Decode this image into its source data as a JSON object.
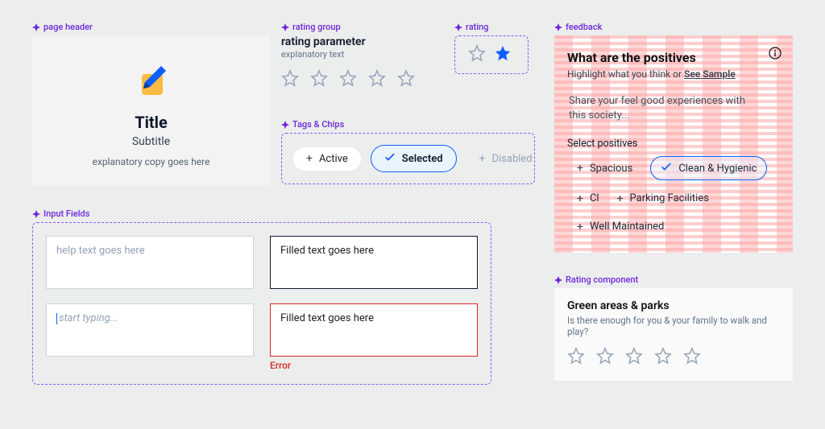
{
  "labels": {
    "page_header": "page header",
    "rating_group": "rating group",
    "rating": "rating",
    "tags_chips": "Tags & Chips",
    "input_fields": "Input Fields",
    "feedback": "feedback",
    "rating_component": "Rating component"
  },
  "page_header": {
    "title": "Title",
    "subtitle": "Subtitle",
    "copy": "explanatory copy goes here"
  },
  "rating_group": {
    "title": "rating parameter",
    "subtitle": "explanatory text"
  },
  "chips": {
    "active": "Active",
    "selected": "Selected",
    "disabled": "Disabled"
  },
  "inputs": {
    "placeholder": "help text goes here",
    "filled1": "Filled text goes here",
    "typing": "start typing...",
    "filled2": "Filled text goes here",
    "error": "Error"
  },
  "feedback": {
    "title": "What are the positives",
    "subtitle_prefix": "Highlight what you think or ",
    "sample": "See Sample",
    "prompt": "Share your feel good experiences with this society...",
    "group_label": "Select positives",
    "chips": {
      "c1": "Spacious",
      "c2": "Clean & Hygienic",
      "c3": "Cl",
      "c4": "Parking Facilities",
      "c5": "Well Maintained"
    }
  },
  "rating_component": {
    "title": "Green areas & parks",
    "subtitle": "Is there enough for you & your family to walk and play?"
  }
}
